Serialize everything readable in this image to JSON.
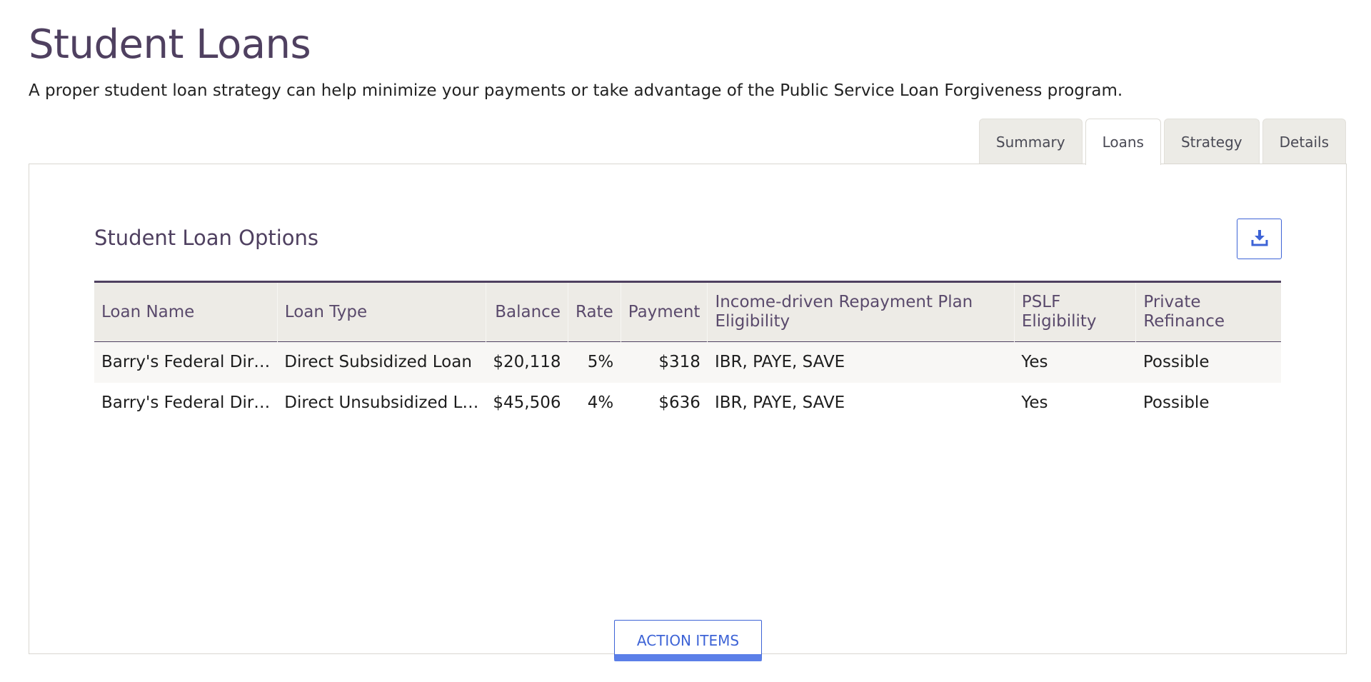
{
  "header": {
    "title": "Student Loans",
    "subtitle": "A proper student loan strategy can help minimize your payments or take advantage of the Public Service Loan Forgiveness program."
  },
  "tabs": [
    {
      "label": "Summary",
      "active": false
    },
    {
      "label": "Loans",
      "active": true
    },
    {
      "label": "Strategy",
      "active": false
    },
    {
      "label": "Details",
      "active": false
    }
  ],
  "section": {
    "title": "Student Loan Options",
    "download_icon": "download-icon"
  },
  "table": {
    "columns": {
      "loan_name": "Loan Name",
      "loan_type": "Loan Type",
      "balance": "Balance",
      "rate": "Rate",
      "payment": "Payment",
      "idr": "Income-driven Repayment Plan Eligibility",
      "pslf": "PSLF Eligibility",
      "refinance": "Private Refinance"
    },
    "rows": [
      {
        "loan_name": "Barry's Federal Dir…",
        "loan_type": "Direct Subsidized Loan",
        "balance": "$20,118",
        "rate": "5%",
        "payment": "$318",
        "idr": "IBR, PAYE, SAVE",
        "pslf": "Yes",
        "refinance": "Possible"
      },
      {
        "loan_name": "Barry's Federal Dir…",
        "loan_type": "Direct Unsubsidized L…",
        "balance": "$45,506",
        "rate": "4%",
        "payment": "$636",
        "idr": "IBR, PAYE, SAVE",
        "pslf": "Yes",
        "refinance": "Possible"
      }
    ]
  },
  "actions": {
    "action_items_label": "ACTION ITEMS"
  },
  "colors": {
    "title": "#4f4060",
    "accent": "#3d63d6",
    "tab_bg": "#ecebe6",
    "header_bg": "#edebe6"
  }
}
